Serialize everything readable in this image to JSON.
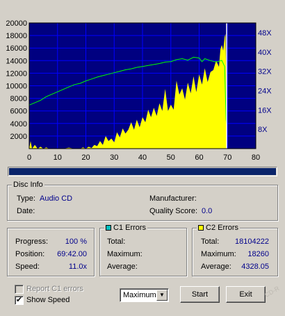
{
  "chart_data": {
    "type": "area",
    "x_ticks": [
      0,
      10,
      20,
      30,
      40,
      50,
      60,
      70,
      80
    ],
    "y_left_ticks": [
      2000,
      4000,
      6000,
      8000,
      10000,
      12000,
      14000,
      16000,
      18000,
      20000
    ],
    "y_right_ticks": [
      "8X",
      "16X",
      "24X",
      "32X",
      "40X",
      "48X"
    ],
    "xlim": [
      0,
      80
    ],
    "ylim_left": [
      0,
      20000
    ],
    "ylim_right": [
      0,
      52
    ],
    "grid": true,
    "background": "#000080",
    "grid_color": "#0000ff",
    "end_marker_x": 69.7,
    "series": [
      {
        "role": "C2 errors",
        "color": "#ffff00",
        "type": "area",
        "points": [
          [
            0,
            0
          ],
          [
            0.5,
            1200
          ],
          [
            1,
            0
          ],
          [
            2,
            600
          ],
          [
            3,
            0
          ],
          [
            4,
            300
          ],
          [
            5,
            0
          ],
          [
            6,
            200
          ],
          [
            7,
            0
          ],
          [
            10,
            0
          ],
          [
            12,
            0
          ],
          [
            14,
            150
          ],
          [
            16,
            0
          ],
          [
            18,
            0
          ],
          [
            19,
            200
          ],
          [
            20,
            0
          ],
          [
            21,
            300
          ],
          [
            22,
            100
          ],
          [
            23,
            600
          ],
          [
            24,
            400
          ],
          [
            25,
            1200
          ],
          [
            26,
            600
          ],
          [
            27,
            2000
          ],
          [
            28,
            1200
          ],
          [
            29,
            1600
          ],
          [
            30,
            1000
          ],
          [
            31,
            2600
          ],
          [
            32,
            1800
          ],
          [
            33,
            3200
          ],
          [
            34,
            2400
          ],
          [
            35,
            3000
          ],
          [
            36,
            4200
          ],
          [
            37,
            3000
          ],
          [
            38,
            4600
          ],
          [
            39,
            3400
          ],
          [
            40,
            5000
          ],
          [
            41,
            4200
          ],
          [
            42,
            6200
          ],
          [
            43,
            5000
          ],
          [
            44,
            6500
          ],
          [
            45,
            5200
          ],
          [
            46,
            7200
          ],
          [
            47,
            6000
          ],
          [
            48,
            9500
          ],
          [
            49,
            6000
          ],
          [
            50,
            7000
          ],
          [
            51,
            6200
          ],
          [
            52,
            10800
          ],
          [
            53,
            8600
          ],
          [
            54,
            9600
          ],
          [
            55,
            7800
          ],
          [
            56,
            10500
          ],
          [
            57,
            8800
          ],
          [
            58,
            11500
          ],
          [
            59,
            9000
          ],
          [
            60,
            11800
          ],
          [
            61,
            10200
          ],
          [
            62,
            12800
          ],
          [
            63,
            10600
          ],
          [
            64,
            12200
          ],
          [
            65,
            12500
          ],
          [
            66,
            14000
          ],
          [
            67,
            13000
          ],
          [
            67.5,
            15800
          ],
          [
            68,
            16500
          ],
          [
            68.5,
            15600
          ],
          [
            69,
            17800
          ],
          [
            69.3,
            18260
          ],
          [
            69.5,
            13000
          ],
          [
            69.6,
            4000
          ],
          [
            69.7,
            0
          ]
        ]
      },
      {
        "role": "Read speed",
        "color": "#00ff00",
        "type": "line",
        "axis": "right",
        "points": [
          [
            0,
            18
          ],
          [
            2,
            19
          ],
          [
            4,
            20
          ],
          [
            6,
            21.5
          ],
          [
            8,
            22.5
          ],
          [
            10,
            23.5
          ],
          [
            12,
            24.5
          ],
          [
            14,
            25.5
          ],
          [
            16,
            26.5
          ],
          [
            18,
            27
          ],
          [
            20,
            28
          ],
          [
            22,
            28.8
          ],
          [
            24,
            29.6
          ],
          [
            26,
            30.2
          ],
          [
            28,
            30.8
          ],
          [
            30,
            31.4
          ],
          [
            32,
            32
          ],
          [
            34,
            32.6
          ],
          [
            36,
            33
          ],
          [
            38,
            33.6
          ],
          [
            40,
            34
          ],
          [
            42,
            34.4
          ],
          [
            44,
            34.8
          ],
          [
            46,
            35.2
          ],
          [
            48,
            35.8
          ],
          [
            50,
            36
          ],
          [
            52,
            36.8
          ],
          [
            54,
            37.2
          ],
          [
            56,
            36.6
          ],
          [
            58,
            37.8
          ],
          [
            60,
            37.5
          ],
          [
            61,
            36
          ],
          [
            62,
            37.2
          ],
          [
            64,
            36.4
          ],
          [
            66,
            35.8
          ],
          [
            68,
            36.5
          ],
          [
            69,
            34
          ],
          [
            69.5,
            12
          ],
          [
            69.7,
            10
          ]
        ]
      }
    ]
  },
  "progress_bar": {
    "value": 1.0
  },
  "disc_info": {
    "title": "Disc Info",
    "type_label": "Type:",
    "type_value": "Audio CD",
    "date_label": "Date:",
    "manufacturer_label": "Manufacturer:",
    "quality_label": "Quality Score:",
    "quality_value": "0.0"
  },
  "status": {
    "progress_label": "Progress:",
    "progress_value": "100 %",
    "position_label": "Position:",
    "position_value": "69:42.00",
    "speed_label": "Speed:",
    "speed_value": "11.0x"
  },
  "c1": {
    "title": "C1 Errors",
    "color": "#00c0c0",
    "total_label": "Total:",
    "maximum_label": "Maximum:",
    "average_label": "Average:"
  },
  "c2": {
    "title": "C2 Errors",
    "color": "#ffff00",
    "total_label": "Total:",
    "total_value": "18104222",
    "maximum_label": "Maximum:",
    "maximum_value": "18260",
    "average_label": "Average:",
    "average_value": "4328.05"
  },
  "controls": {
    "report_c1_label": "Report C1 errors",
    "show_speed_label": "Show Speed",
    "show_speed_check": "✔",
    "mode_value": "Maximum",
    "mode_arrow": "▼",
    "start_label": "Start",
    "exit_label": "Exit"
  },
  "watermark": "CD-R"
}
